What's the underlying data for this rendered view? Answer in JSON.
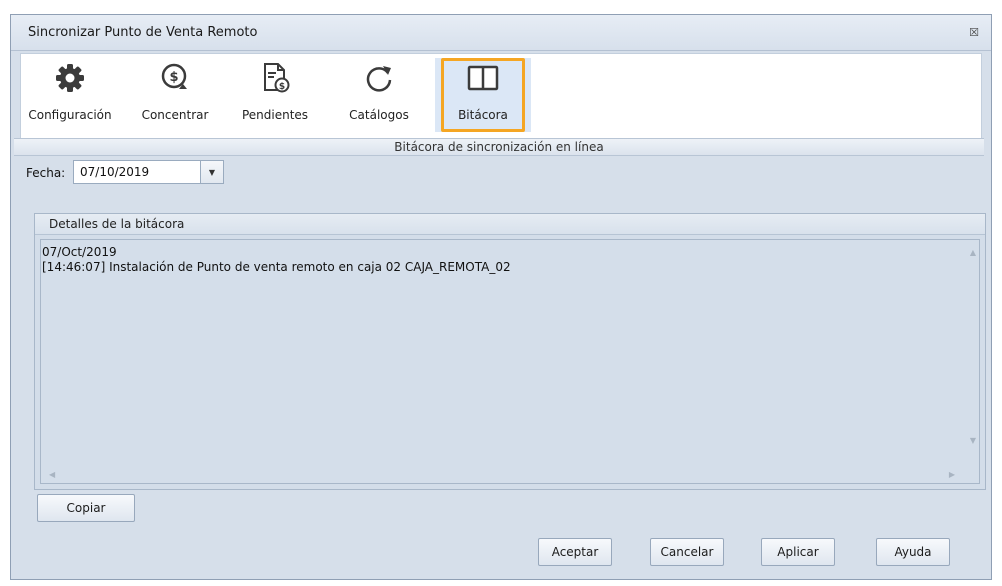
{
  "window": {
    "title": "Sincronizar Punto de Venta Remoto",
    "close_glyph": "☒"
  },
  "ribbon": {
    "items": [
      {
        "label": "Configuración",
        "icon": "gear-icon"
      },
      {
        "label": "Concentrar",
        "icon": "money-refresh-icon"
      },
      {
        "label": "Pendientes",
        "icon": "document-money-icon"
      },
      {
        "label": "Catálogos",
        "icon": "refresh-icon"
      },
      {
        "label": "Bitácora",
        "icon": "book-icon",
        "active": true
      }
    ],
    "active_border_color": "#f5a623"
  },
  "section": {
    "title": "Bitácora de sincronización en línea"
  },
  "fecha": {
    "label": "Fecha:",
    "value": "07/10/2019"
  },
  "details": {
    "title": "Detalles de la bitácora",
    "log": "07/Oct/2019\n[14:46:07] Instalación de Punto de venta remoto en caja 02 CAJA_REMOTA_02"
  },
  "buttons": {
    "copiar": "Copiar",
    "aceptar": "Aceptar",
    "cancelar": "Cancelar",
    "aplicar": "Aplicar",
    "ayuda": "Ayuda"
  }
}
